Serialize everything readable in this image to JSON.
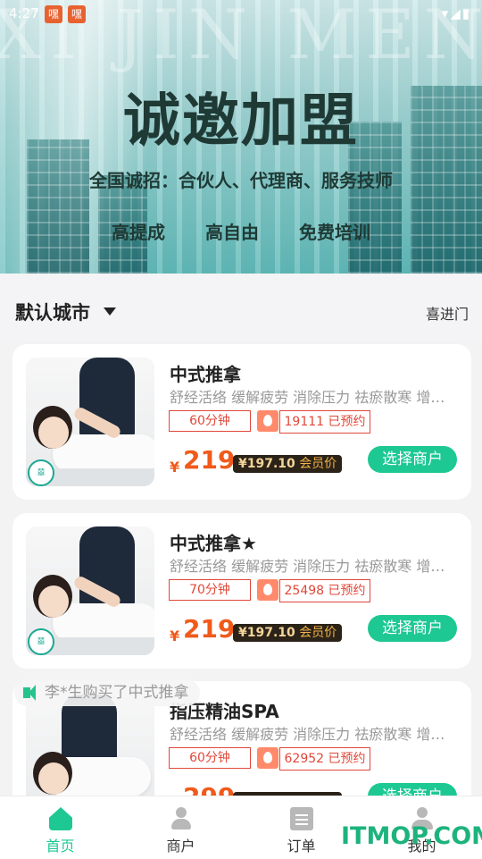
{
  "status": {
    "time": "4:27",
    "notif1": "嘿",
    "notif2": "嘿"
  },
  "banner": {
    "watermark": "XI JIN MEN",
    "headline": "诚邀加盟",
    "sub1": "全国诚招：合伙人、代理商、服务技师",
    "perks": [
      "高提成",
      "高自由",
      "免费培训"
    ]
  },
  "filter": {
    "city": "默认城市",
    "shop": "喜进门"
  },
  "cards": [
    {
      "title": "中式推拿",
      "desc": "舒经活络 缓解疲劳 消除压力 祛瘀散寒 增…",
      "duration": "60分钟",
      "booked": "19111 已预约",
      "currency": "¥",
      "price": "219",
      "member_price": "¥197.10",
      "member_label": "会员价",
      "button": "选择商户"
    },
    {
      "title": "中式推拿★",
      "desc": "舒经活络 缓解疲劳 消除压力 祛瘀散寒 增…",
      "duration": "70分钟",
      "booked": "25498 已预约",
      "currency": "¥",
      "price": "219",
      "member_price": "¥197.10",
      "member_label": "会员价",
      "button": "选择商户"
    },
    {
      "title": "指压精油SPA",
      "desc": "舒经活络 缓解疲劳 消除压力 祛瘀散寒 增…",
      "duration": "60分钟",
      "booked": "62952 已预约",
      "currency": "¥",
      "price": "299",
      "member_price": "",
      "member_label": "",
      "button": "选择商户"
    }
  ],
  "toast": "李*生购买了中式推拿",
  "tabs": [
    {
      "label": "首页",
      "icon": "home-icon"
    },
    {
      "label": "商户",
      "icon": "merchant-icon"
    },
    {
      "label": "订单",
      "icon": "order-icon"
    },
    {
      "label": "我的",
      "icon": "profile-icon"
    }
  ],
  "watermark_site": "ITMOP.COM",
  "colors": {
    "accent": "#1dc893",
    "price": "#f05a1a",
    "tag": "#e0483a"
  }
}
